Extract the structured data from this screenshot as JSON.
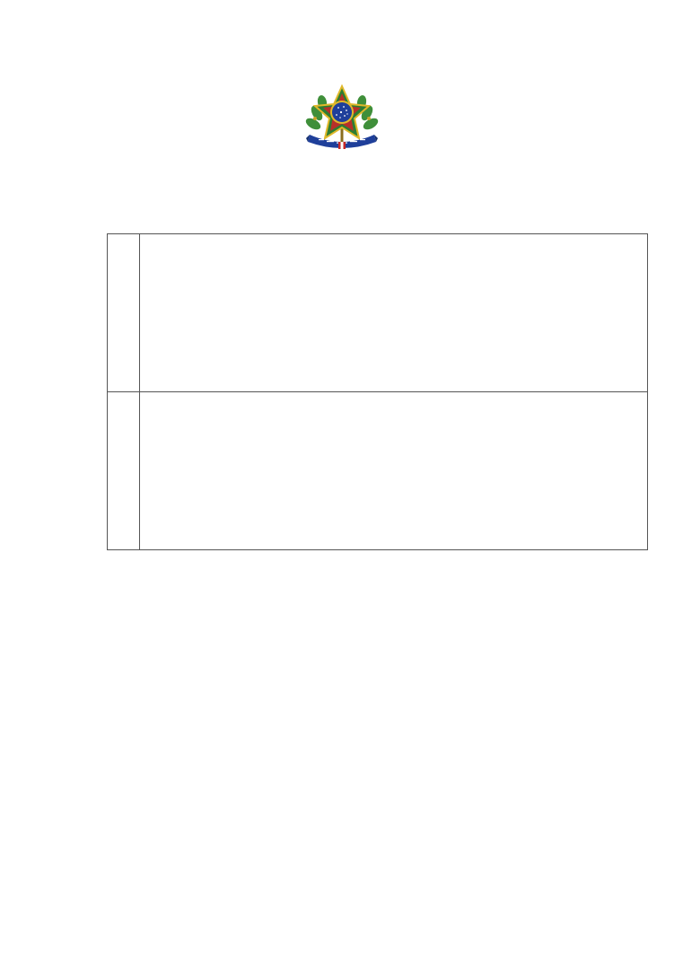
{
  "document": {
    "emblem": {
      "icon": "brazil-coat-of-arms-icon",
      "colors": {
        "green": "#2e7d32",
        "gold": "#e0b82a",
        "blue": "#1f3f9a",
        "red": "#c62828"
      }
    },
    "table": {
      "rows": [
        {
          "number": "",
          "content": ""
        },
        {
          "number": "",
          "content": ""
        }
      ]
    }
  }
}
